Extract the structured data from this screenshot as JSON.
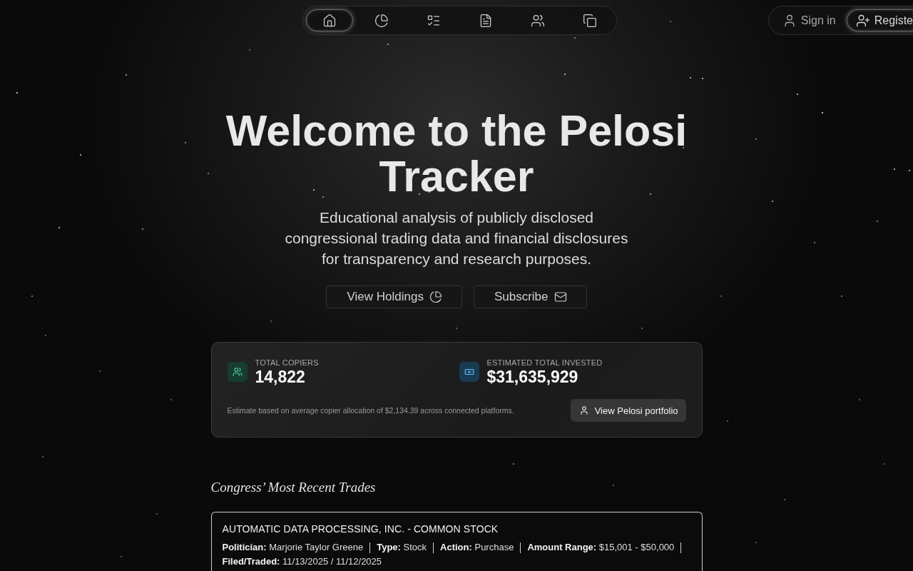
{
  "nav": {
    "tabs": [
      {
        "selected": true
      },
      {
        "selected": false
      },
      {
        "selected": false
      },
      {
        "selected": false
      },
      {
        "selected": false
      },
      {
        "selected": false
      }
    ]
  },
  "auth": {
    "buttons": [
      {
        "label": "Sign in",
        "highlighted": false
      },
      {
        "label": "Registe",
        "highlighted": true
      }
    ]
  },
  "hero": {
    "title": "Welcome to the Pelosi Tracker",
    "subtitle": "Educational analysis of publicly disclosed congressional trading data and financial disclosures for transparency and research purposes.",
    "buttons": [
      {
        "label": "View Holdings"
      },
      {
        "label": "Subscribe"
      }
    ]
  },
  "stats": {
    "items": [
      {
        "label": "TOTAL COPIERS",
        "value": "14,822",
        "color": "#173d2f"
      },
      {
        "label": "ESTIMATED TOTAL INVESTED",
        "value": "$31,635,929",
        "color": "#183b52"
      }
    ],
    "note": "Estimate based on average copier allocation of $2,134.39 across connected platforms.",
    "button": "View Pelosi portfolio"
  },
  "recent_trades": {
    "heading": "Congress’ Most Recent Trades",
    "trades": [
      {
        "title": "AUTOMATIC DATA PROCESSING, INC. - COMMON STOCK",
        "details": [
          "**Politician:** Marjorie Taylor Greene",
          "**Type:** Stock",
          "**Action:** Purchase",
          "**Amount Range:** $15,001 - $50,000",
          "**Filed/Traded:** 11/13/2025 / 11/12/2025"
        ]
      }
    ]
  }
}
